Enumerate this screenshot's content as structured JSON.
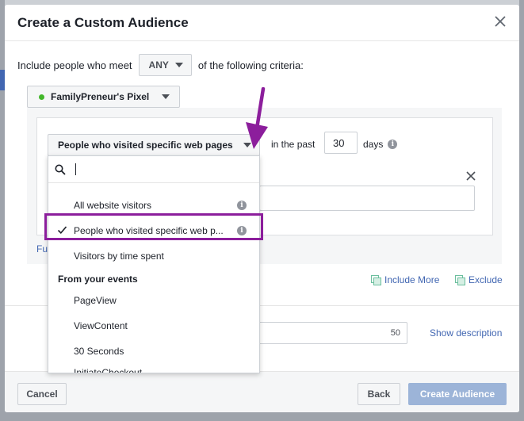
{
  "modal": {
    "title": "Create a Custom Audience"
  },
  "criteria": {
    "prefix": "Include people who meet",
    "match_value": "ANY",
    "suffix": "of the following criteria:"
  },
  "pixel": {
    "name": "FamilyPreneur's Pixel"
  },
  "rule": {
    "type_selected": "People who visited specific web pages",
    "in_the_past": "in the past",
    "days_value": "30",
    "days_label": "days",
    "fu_fragment": "Fu"
  },
  "dropdown": {
    "search_value": "",
    "items": [
      {
        "label": "All website visitors",
        "info": true,
        "checked": false
      },
      {
        "label": "People who visited specific web p...",
        "info": true,
        "checked": true
      },
      {
        "label": "Visitors by time spent",
        "info": false,
        "checked": false
      }
    ],
    "section_title": "From your events",
    "event_items": [
      "PageView",
      "ViewContent",
      "30 Seconds",
      "InitiateCheckout"
    ]
  },
  "actions": {
    "include_more": "Include More",
    "exclude": "Exclude"
  },
  "audience_name": {
    "char_limit": "50",
    "show_description": "Show description"
  },
  "footer": {
    "cancel": "Cancel",
    "back": "Back",
    "create": "Create Audience"
  },
  "colors": {
    "annotation": "#8c1e9c",
    "link": "#4267b2",
    "primary_disabled": "#9cb4d8",
    "pixel_status": "#42b72a"
  },
  "icons": {
    "close": "close-icon",
    "caret": "caret-down-icon",
    "search": "search-icon",
    "check": "checkmark-icon",
    "info": "info-icon",
    "copy": "copy-icon",
    "arrow": "annotation-arrow"
  }
}
